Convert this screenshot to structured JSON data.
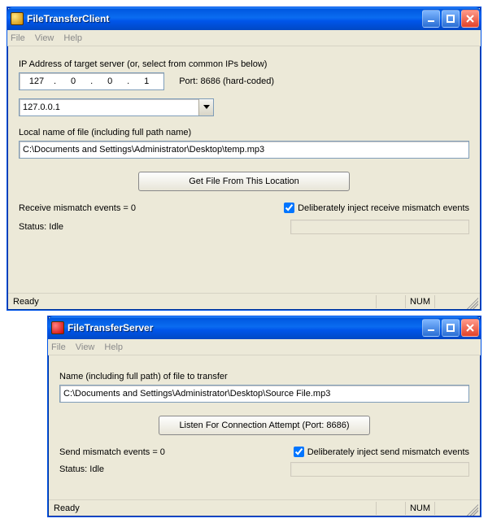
{
  "client": {
    "title": "FileTransferClient",
    "menu": {
      "file": "File",
      "view": "View",
      "help": "Help"
    },
    "ip_label": "IP Address of target server (or, select from common IPs below)",
    "ip_octets": [
      "127",
      "0",
      "0",
      "1"
    ],
    "port_label": "Port: 8686 (hard-coded)",
    "dropdown_selected": "127.0.0.1",
    "file_label": "Local name of file (including full path name)",
    "file_value": "C:\\Documents and Settings\\Administrator\\Desktop\\temp.mp3",
    "get_button": "Get File From This Location",
    "mismatch_label": "Receive mismatch events = 0",
    "inject_label": "Deliberately inject receive mismatch events",
    "status_label": "Status: Idle",
    "statusbar_ready": "Ready",
    "statusbar_num": "NUM"
  },
  "server": {
    "title": "FileTransferServer",
    "menu": {
      "file": "File",
      "view": "View",
      "help": "Help"
    },
    "file_label": "Name (including full path) of file to transfer",
    "file_value": "C:\\Documents and Settings\\Administrator\\Desktop\\Source File.mp3",
    "listen_button": "Listen For Connection Attempt (Port: 8686)",
    "mismatch_label": "Send mismatch events = 0",
    "inject_label": "Deliberately inject send mismatch events",
    "status_label": "Status: Idle",
    "statusbar_ready": "Ready",
    "statusbar_num": "NUM"
  }
}
